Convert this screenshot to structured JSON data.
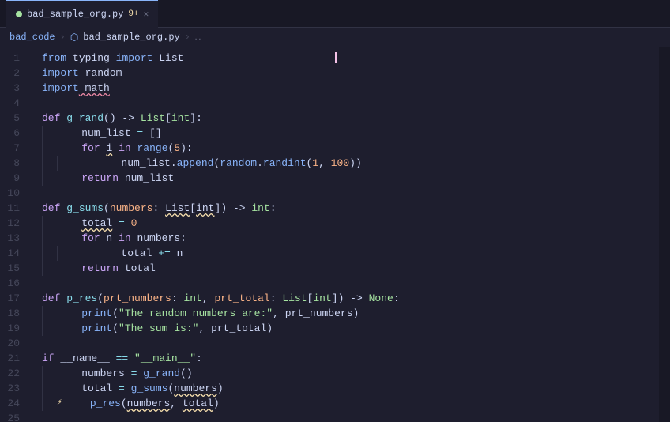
{
  "titleBar": {
    "tab": {
      "label": "bad_sample_org.py",
      "modified": "9+",
      "close": "✕"
    }
  },
  "breadcrumb": {
    "parts": [
      "bad_code",
      ">",
      "bad_sample_org.py",
      ">",
      "..."
    ]
  },
  "lines": [
    {
      "num": 1,
      "tokens": [
        {
          "t": "kw2",
          "v": "from"
        },
        {
          "t": "var",
          "v": " typing "
        },
        {
          "t": "kw2",
          "v": "import"
        },
        {
          "t": "var",
          "v": " List"
        }
      ]
    },
    {
      "num": 2,
      "tokens": [
        {
          "t": "kw2",
          "v": "import"
        },
        {
          "t": "var",
          "v": " random"
        }
      ]
    },
    {
      "num": 3,
      "tokens": [
        {
          "t": "kw2",
          "v": "import"
        },
        {
          "t": "squiggle",
          "v": " math"
        }
      ]
    },
    {
      "num": 4,
      "tokens": []
    },
    {
      "num": 5,
      "tokens": [
        {
          "t": "kw",
          "v": "def"
        },
        {
          "t": "var",
          "v": " "
        },
        {
          "t": "fn-def",
          "v": "g_rand"
        },
        {
          "t": "punct",
          "v": "() -> "
        },
        {
          "t": "type",
          "v": "List"
        },
        {
          "t": "punct",
          "v": "["
        },
        {
          "t": "type",
          "v": "int"
        },
        {
          "t": "punct",
          "v": "]:"
        }
      ]
    },
    {
      "num": 6,
      "tokens": [
        {
          "t": "var",
          "v": "    num_list "
        },
        {
          "t": "op",
          "v": "="
        },
        {
          "t": "var",
          "v": " "
        },
        {
          "t": "punct",
          "v": "[]"
        }
      ]
    },
    {
      "num": 7,
      "tokens": [
        {
          "t": "var",
          "v": "    "
        },
        {
          "t": "kw",
          "v": "for"
        },
        {
          "t": "var",
          "v": " "
        },
        {
          "t": "squiggle-warn",
          "v": "i"
        },
        {
          "t": "var",
          "v": " "
        },
        {
          "t": "kw",
          "v": "in"
        },
        {
          "t": "var",
          "v": " "
        },
        {
          "t": "builtin",
          "v": "range"
        },
        {
          "t": "punct",
          "v": "("
        },
        {
          "t": "num",
          "v": "5"
        },
        {
          "t": "punct",
          "v": "):"
        }
      ]
    },
    {
      "num": 8,
      "tokens": [
        {
          "t": "var",
          "v": "        num_list"
        },
        {
          "t": "punct",
          "v": "."
        },
        {
          "t": "fn",
          "v": "append"
        },
        {
          "t": "punct",
          "v": "("
        },
        {
          "t": "builtin",
          "v": "random"
        },
        {
          "t": "punct",
          "v": "."
        },
        {
          "t": "fn",
          "v": "randint"
        },
        {
          "t": "punct",
          "v": "("
        },
        {
          "t": "num",
          "v": "1"
        },
        {
          "t": "punct",
          "v": ", "
        },
        {
          "t": "num",
          "v": "100"
        },
        {
          "t": "punct",
          "v": "))"
        }
      ]
    },
    {
      "num": 9,
      "tokens": [
        {
          "t": "var",
          "v": "    "
        },
        {
          "t": "kw",
          "v": "return"
        },
        {
          "t": "var",
          "v": " num_list"
        }
      ]
    },
    {
      "num": 10,
      "tokens": []
    },
    {
      "num": 11,
      "tokens": [
        {
          "t": "kw",
          "v": "def"
        },
        {
          "t": "var",
          "v": " "
        },
        {
          "t": "fn-def",
          "v": "g_sums"
        },
        {
          "t": "punct",
          "v": "("
        },
        {
          "t": "param",
          "v": "numbers"
        },
        {
          "t": "punct",
          "v": ": "
        },
        {
          "t": "squiggle-warn",
          "v": "List"
        },
        {
          "t": "punct",
          "v": "["
        },
        {
          "t": "squiggle-warn",
          "v": "int"
        },
        {
          "t": "punct",
          "v": "]"
        },
        {
          "t": "punct",
          "v": ") -> "
        },
        {
          "t": "type",
          "v": "int"
        },
        {
          "t": "punct",
          "v": ":"
        }
      ]
    },
    {
      "num": 12,
      "tokens": [
        {
          "t": "var",
          "v": "    "
        },
        {
          "t": "squiggle-warn",
          "v": "total"
        },
        {
          "t": "var",
          "v": " "
        },
        {
          "t": "op",
          "v": "="
        },
        {
          "t": "var",
          "v": " "
        },
        {
          "t": "num",
          "v": "0"
        }
      ]
    },
    {
      "num": 13,
      "tokens": [
        {
          "t": "var",
          "v": "    "
        },
        {
          "t": "kw",
          "v": "for"
        },
        {
          "t": "var",
          "v": " n "
        },
        {
          "t": "kw",
          "v": "in"
        },
        {
          "t": "var",
          "v": " numbers:"
        }
      ]
    },
    {
      "num": 14,
      "tokens": [
        {
          "t": "var",
          "v": "        total "
        },
        {
          "t": "op",
          "v": "+="
        },
        {
          "t": "var",
          "v": " n"
        }
      ]
    },
    {
      "num": 15,
      "tokens": [
        {
          "t": "var",
          "v": "    "
        },
        {
          "t": "kw",
          "v": "return"
        },
        {
          "t": "var",
          "v": " total"
        }
      ]
    },
    {
      "num": 16,
      "tokens": []
    },
    {
      "num": 17,
      "tokens": [
        {
          "t": "kw",
          "v": "def"
        },
        {
          "t": "var",
          "v": " "
        },
        {
          "t": "fn-def",
          "v": "p_res"
        },
        {
          "t": "punct",
          "v": "("
        },
        {
          "t": "param",
          "v": "prt_numbers"
        },
        {
          "t": "punct",
          "v": ": "
        },
        {
          "t": "type",
          "v": "int"
        },
        {
          "t": "punct",
          "v": ", "
        },
        {
          "t": "param",
          "v": "prt_total"
        },
        {
          "t": "punct",
          "v": ": "
        },
        {
          "t": "type",
          "v": "List"
        },
        {
          "t": "punct",
          "v": "["
        },
        {
          "t": "type",
          "v": "int"
        },
        {
          "t": "punct",
          "v": "]"
        },
        {
          "t": "punct",
          "v": ") -> "
        },
        {
          "t": "type",
          "v": "None"
        },
        {
          "t": "punct",
          "v": ":"
        }
      ]
    },
    {
      "num": 18,
      "tokens": [
        {
          "t": "var",
          "v": "    "
        },
        {
          "t": "builtin",
          "v": "print"
        },
        {
          "t": "punct",
          "v": "("
        },
        {
          "t": "str",
          "v": "\"The random numbers are:\""
        },
        {
          "t": "punct",
          "v": ", prt_numbers)"
        }
      ]
    },
    {
      "num": 19,
      "tokens": [
        {
          "t": "var",
          "v": "    "
        },
        {
          "t": "builtin",
          "v": "print"
        },
        {
          "t": "punct",
          "v": "("
        },
        {
          "t": "str",
          "v": "\"The sum is:\""
        },
        {
          "t": "punct",
          "v": ", prt_total)"
        }
      ]
    },
    {
      "num": 20,
      "tokens": []
    },
    {
      "num": 21,
      "tokens": [
        {
          "t": "kw",
          "v": "if"
        },
        {
          "t": "var",
          "v": " __name__ "
        },
        {
          "t": "op",
          "v": "=="
        },
        {
          "t": "var",
          "v": " "
        },
        {
          "t": "str",
          "v": "\"__main__\""
        },
        {
          "t": "punct",
          "v": ":"
        }
      ]
    },
    {
      "num": 22,
      "tokens": [
        {
          "t": "var",
          "v": "    numbers "
        },
        {
          "t": "op",
          "v": "="
        },
        {
          "t": "var",
          "v": " "
        },
        {
          "t": "fn",
          "v": "g_rand"
        },
        {
          "t": "punct",
          "v": "()"
        }
      ]
    },
    {
      "num": 23,
      "tokens": [
        {
          "t": "var",
          "v": "    total "
        },
        {
          "t": "op",
          "v": "="
        },
        {
          "t": "var",
          "v": " "
        },
        {
          "t": "fn",
          "v": "g_sums"
        },
        {
          "t": "punct",
          "v": "("
        },
        {
          "t": "squiggle-warn",
          "v": "numbers"
        },
        {
          "t": "punct",
          "v": ")"
        }
      ]
    },
    {
      "num": 24,
      "tokens": [
        {
          "t": "warn",
          "v": "⚡"
        },
        {
          "t": "var",
          "v": "    "
        },
        {
          "t": "fn",
          "v": "p_res"
        },
        {
          "t": "punct",
          "v": "("
        },
        {
          "t": "squiggle-warn",
          "v": "numbers"
        },
        {
          "t": "punct",
          "v": ", "
        },
        {
          "t": "squiggle-warn",
          "v": "total"
        },
        {
          "t": "punct",
          "v": ")"
        }
      ]
    },
    {
      "num": 25,
      "tokens": []
    }
  ]
}
